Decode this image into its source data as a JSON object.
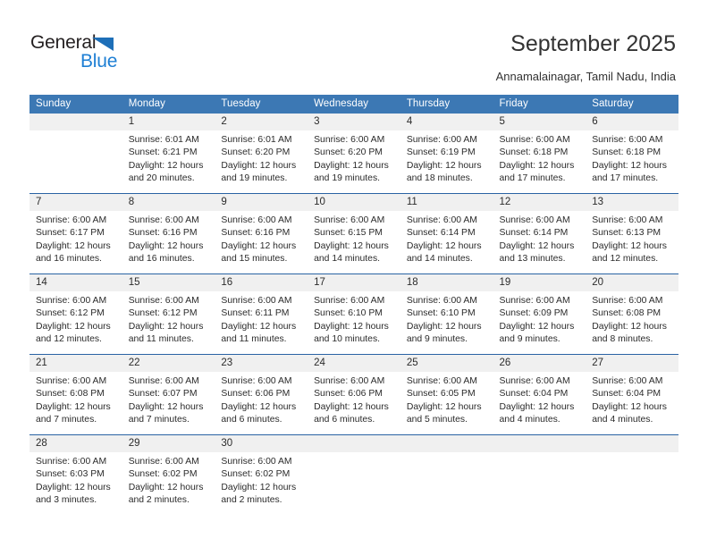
{
  "brand": {
    "name_part1": "General",
    "name_part2": "Blue"
  },
  "header": {
    "title": "September 2025",
    "subtitle": "Annamalainagar, Tamil Nadu, India"
  },
  "weekday_headers": [
    "Sunday",
    "Monday",
    "Tuesday",
    "Wednesday",
    "Thursday",
    "Friday",
    "Saturday"
  ],
  "colors": {
    "header_blue": "#3c78b4",
    "row_divider_blue": "#2a63a4",
    "daynum_band": "#f0f0f0",
    "logo_blue": "#1e7fd4",
    "logo_triangle": "#1e6fb8",
    "text": "#2b2b2b"
  },
  "weeks": [
    [
      {
        "day": "",
        "empty": true,
        "sunrise": "",
        "sunset": "",
        "daylight1": "",
        "daylight2": ""
      },
      {
        "day": "1",
        "empty": false,
        "sunrise": "Sunrise: 6:01 AM",
        "sunset": "Sunset: 6:21 PM",
        "daylight1": "Daylight: 12 hours",
        "daylight2": "and 20 minutes."
      },
      {
        "day": "2",
        "empty": false,
        "sunrise": "Sunrise: 6:01 AM",
        "sunset": "Sunset: 6:20 PM",
        "daylight1": "Daylight: 12 hours",
        "daylight2": "and 19 minutes."
      },
      {
        "day": "3",
        "empty": false,
        "sunrise": "Sunrise: 6:00 AM",
        "sunset": "Sunset: 6:20 PM",
        "daylight1": "Daylight: 12 hours",
        "daylight2": "and 19 minutes."
      },
      {
        "day": "4",
        "empty": false,
        "sunrise": "Sunrise: 6:00 AM",
        "sunset": "Sunset: 6:19 PM",
        "daylight1": "Daylight: 12 hours",
        "daylight2": "and 18 minutes."
      },
      {
        "day": "5",
        "empty": false,
        "sunrise": "Sunrise: 6:00 AM",
        "sunset": "Sunset: 6:18 PM",
        "daylight1": "Daylight: 12 hours",
        "daylight2": "and 17 minutes."
      },
      {
        "day": "6",
        "empty": false,
        "sunrise": "Sunrise: 6:00 AM",
        "sunset": "Sunset: 6:18 PM",
        "daylight1": "Daylight: 12 hours",
        "daylight2": "and 17 minutes."
      }
    ],
    [
      {
        "day": "7",
        "empty": false,
        "sunrise": "Sunrise: 6:00 AM",
        "sunset": "Sunset: 6:17 PM",
        "daylight1": "Daylight: 12 hours",
        "daylight2": "and 16 minutes."
      },
      {
        "day": "8",
        "empty": false,
        "sunrise": "Sunrise: 6:00 AM",
        "sunset": "Sunset: 6:16 PM",
        "daylight1": "Daylight: 12 hours",
        "daylight2": "and 16 minutes."
      },
      {
        "day": "9",
        "empty": false,
        "sunrise": "Sunrise: 6:00 AM",
        "sunset": "Sunset: 6:16 PM",
        "daylight1": "Daylight: 12 hours",
        "daylight2": "and 15 minutes."
      },
      {
        "day": "10",
        "empty": false,
        "sunrise": "Sunrise: 6:00 AM",
        "sunset": "Sunset: 6:15 PM",
        "daylight1": "Daylight: 12 hours",
        "daylight2": "and 14 minutes."
      },
      {
        "day": "11",
        "empty": false,
        "sunrise": "Sunrise: 6:00 AM",
        "sunset": "Sunset: 6:14 PM",
        "daylight1": "Daylight: 12 hours",
        "daylight2": "and 14 minutes."
      },
      {
        "day": "12",
        "empty": false,
        "sunrise": "Sunrise: 6:00 AM",
        "sunset": "Sunset: 6:14 PM",
        "daylight1": "Daylight: 12 hours",
        "daylight2": "and 13 minutes."
      },
      {
        "day": "13",
        "empty": false,
        "sunrise": "Sunrise: 6:00 AM",
        "sunset": "Sunset: 6:13 PM",
        "daylight1": "Daylight: 12 hours",
        "daylight2": "and 12 minutes."
      }
    ],
    [
      {
        "day": "14",
        "empty": false,
        "sunrise": "Sunrise: 6:00 AM",
        "sunset": "Sunset: 6:12 PM",
        "daylight1": "Daylight: 12 hours",
        "daylight2": "and 12 minutes."
      },
      {
        "day": "15",
        "empty": false,
        "sunrise": "Sunrise: 6:00 AM",
        "sunset": "Sunset: 6:12 PM",
        "daylight1": "Daylight: 12 hours",
        "daylight2": "and 11 minutes."
      },
      {
        "day": "16",
        "empty": false,
        "sunrise": "Sunrise: 6:00 AM",
        "sunset": "Sunset: 6:11 PM",
        "daylight1": "Daylight: 12 hours",
        "daylight2": "and 11 minutes."
      },
      {
        "day": "17",
        "empty": false,
        "sunrise": "Sunrise: 6:00 AM",
        "sunset": "Sunset: 6:10 PM",
        "daylight1": "Daylight: 12 hours",
        "daylight2": "and 10 minutes."
      },
      {
        "day": "18",
        "empty": false,
        "sunrise": "Sunrise: 6:00 AM",
        "sunset": "Sunset: 6:10 PM",
        "daylight1": "Daylight: 12 hours",
        "daylight2": "and 9 minutes."
      },
      {
        "day": "19",
        "empty": false,
        "sunrise": "Sunrise: 6:00 AM",
        "sunset": "Sunset: 6:09 PM",
        "daylight1": "Daylight: 12 hours",
        "daylight2": "and 9 minutes."
      },
      {
        "day": "20",
        "empty": false,
        "sunrise": "Sunrise: 6:00 AM",
        "sunset": "Sunset: 6:08 PM",
        "daylight1": "Daylight: 12 hours",
        "daylight2": "and 8 minutes."
      }
    ],
    [
      {
        "day": "21",
        "empty": false,
        "sunrise": "Sunrise: 6:00 AM",
        "sunset": "Sunset: 6:08 PM",
        "daylight1": "Daylight: 12 hours",
        "daylight2": "and 7 minutes."
      },
      {
        "day": "22",
        "empty": false,
        "sunrise": "Sunrise: 6:00 AM",
        "sunset": "Sunset: 6:07 PM",
        "daylight1": "Daylight: 12 hours",
        "daylight2": "and 7 minutes."
      },
      {
        "day": "23",
        "empty": false,
        "sunrise": "Sunrise: 6:00 AM",
        "sunset": "Sunset: 6:06 PM",
        "daylight1": "Daylight: 12 hours",
        "daylight2": "and 6 minutes."
      },
      {
        "day": "24",
        "empty": false,
        "sunrise": "Sunrise: 6:00 AM",
        "sunset": "Sunset: 6:06 PM",
        "daylight1": "Daylight: 12 hours",
        "daylight2": "and 6 minutes."
      },
      {
        "day": "25",
        "empty": false,
        "sunrise": "Sunrise: 6:00 AM",
        "sunset": "Sunset: 6:05 PM",
        "daylight1": "Daylight: 12 hours",
        "daylight2": "and 5 minutes."
      },
      {
        "day": "26",
        "empty": false,
        "sunrise": "Sunrise: 6:00 AM",
        "sunset": "Sunset: 6:04 PM",
        "daylight1": "Daylight: 12 hours",
        "daylight2": "and 4 minutes."
      },
      {
        "day": "27",
        "empty": false,
        "sunrise": "Sunrise: 6:00 AM",
        "sunset": "Sunset: 6:04 PM",
        "daylight1": "Daylight: 12 hours",
        "daylight2": "and 4 minutes."
      }
    ],
    [
      {
        "day": "28",
        "empty": false,
        "sunrise": "Sunrise: 6:00 AM",
        "sunset": "Sunset: 6:03 PM",
        "daylight1": "Daylight: 12 hours",
        "daylight2": "and 3 minutes."
      },
      {
        "day": "29",
        "empty": false,
        "sunrise": "Sunrise: 6:00 AM",
        "sunset": "Sunset: 6:02 PM",
        "daylight1": "Daylight: 12 hours",
        "daylight2": "and 2 minutes."
      },
      {
        "day": "30",
        "empty": false,
        "sunrise": "Sunrise: 6:00 AM",
        "sunset": "Sunset: 6:02 PM",
        "daylight1": "Daylight: 12 hours",
        "daylight2": "and 2 minutes."
      },
      {
        "day": "",
        "empty": true,
        "sunrise": "",
        "sunset": "",
        "daylight1": "",
        "daylight2": ""
      },
      {
        "day": "",
        "empty": true,
        "sunrise": "",
        "sunset": "",
        "daylight1": "",
        "daylight2": ""
      },
      {
        "day": "",
        "empty": true,
        "sunrise": "",
        "sunset": "",
        "daylight1": "",
        "daylight2": ""
      },
      {
        "day": "",
        "empty": true,
        "sunrise": "",
        "sunset": "",
        "daylight1": "",
        "daylight2": ""
      }
    ]
  ]
}
